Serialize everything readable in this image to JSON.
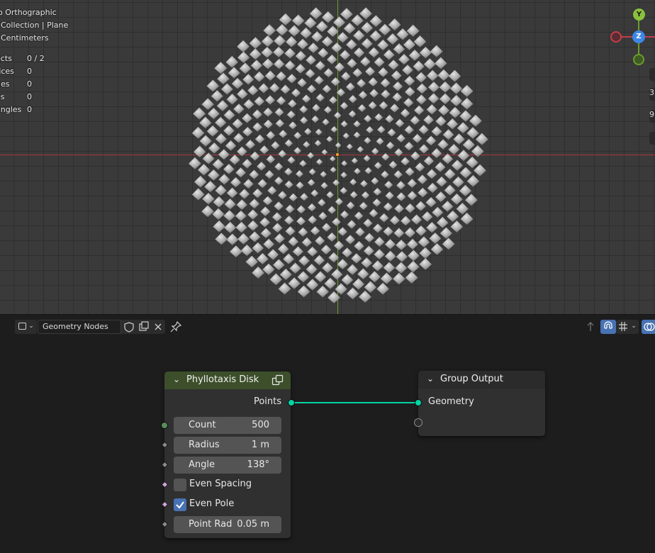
{
  "viewport": {
    "view_name": "Orthographic",
    "view_name_prefix": "o",
    "collection": "Collection | Plane",
    "units": "Centimeters",
    "stats": [
      {
        "label": "ects",
        "value": "0 / 2"
      },
      {
        "label": "tices",
        "value": "0"
      },
      {
        "label": "ges",
        "value": "0"
      },
      {
        "label": "es",
        "value": "0"
      },
      {
        "label": "angles",
        "value": "0"
      }
    ],
    "gizmo": {
      "y": "Y",
      "z": "Z"
    },
    "side_glyphs": [
      "3",
      "9"
    ]
  },
  "editor_header": {
    "node_tree_name": "Geometry Nodes",
    "editor_type_icon": "node-editor-icon",
    "fake_user_icon": "shield-icon",
    "duplicate_icon": "duplicate-icon",
    "unlink_icon": "close-icon",
    "pin_icon": "pin-icon"
  },
  "nodes": {
    "phyllotaxis": {
      "title": "Phyllotaxis Disk",
      "header_color": "#3c4f2a",
      "output_label": "Points",
      "inputs": [
        {
          "label": "Count",
          "value": "500"
        },
        {
          "label": "Radius",
          "value": "1 m"
        },
        {
          "label": "Angle",
          "value": "138°"
        }
      ],
      "even_spacing": {
        "label": "Even Spacing",
        "checked": false
      },
      "even_pole": {
        "label": "Even Pole",
        "checked": true
      },
      "point_rad": {
        "label": "Point Rad",
        "value": "0.05 m"
      }
    },
    "group_output": {
      "title": "Group Output",
      "input_label": "Geometry"
    }
  },
  "colors": {
    "geometry_socket": "#00d4a4",
    "int_socket": "#598c5c",
    "bool_socket": "#cca6d6",
    "axis_x": "#a5363f",
    "axis_y": "#6b9b2c",
    "checkbox_on": "#4772b3"
  }
}
